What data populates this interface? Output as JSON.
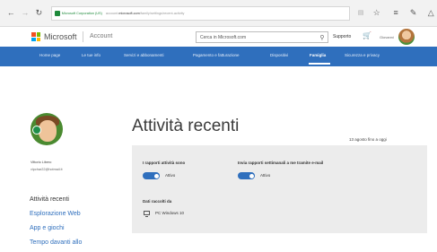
{
  "browser": {
    "back_icon": "arrow-left-icon",
    "forward_icon": "arrow-right-icon",
    "reload_icon": "refresh-icon",
    "url_site": "Microsoft Corporation (US)",
    "url_prefix": "account.",
    "url_domain": "microsoft.com",
    "url_path": "/family/settings/recent-activity"
  },
  "header": {
    "brand": "Microsoft",
    "section": "Account",
    "search_placeholder": "Cerca in Microsoft.com",
    "support": "Supporto",
    "user": "Giovanni"
  },
  "nav": {
    "items": [
      {
        "label": "Home page"
      },
      {
        "label": "Le tue info"
      },
      {
        "label": "Servizi e abbonamenti"
      },
      {
        "label": "Pagamento e fatturazione"
      },
      {
        "label": "Dispositivi"
      },
      {
        "label": "Famiglia"
      },
      {
        "label": "Sicurezza e privacy"
      }
    ],
    "active_index": 5
  },
  "profile": {
    "name": "Vittorio Libero",
    "email": "vlpchar22@hotmail.it"
  },
  "sidebar": {
    "items": [
      {
        "label": "Attività recenti"
      },
      {
        "label": "Esplorazione Web"
      },
      {
        "label": "App e giochi"
      },
      {
        "label": "Tempo davanti allo"
      }
    ],
    "active_index": 0
  },
  "main": {
    "title": "Attività recenti",
    "date_range": "13 agosto fino a oggi",
    "activity_reports": {
      "label": "I rapporti attività sono",
      "state": "Attivo",
      "on": true
    },
    "weekly_email": {
      "label": "Invia rapporti settimanali a me tramite e-mail",
      "state": "Attivo",
      "on": true
    },
    "collected_from_label": "Dati raccolti da",
    "device": "PC Windows 10"
  },
  "colors": {
    "accent": "#2f6fbd",
    "panel": "#ececec",
    "link": "#2f6fbd"
  }
}
